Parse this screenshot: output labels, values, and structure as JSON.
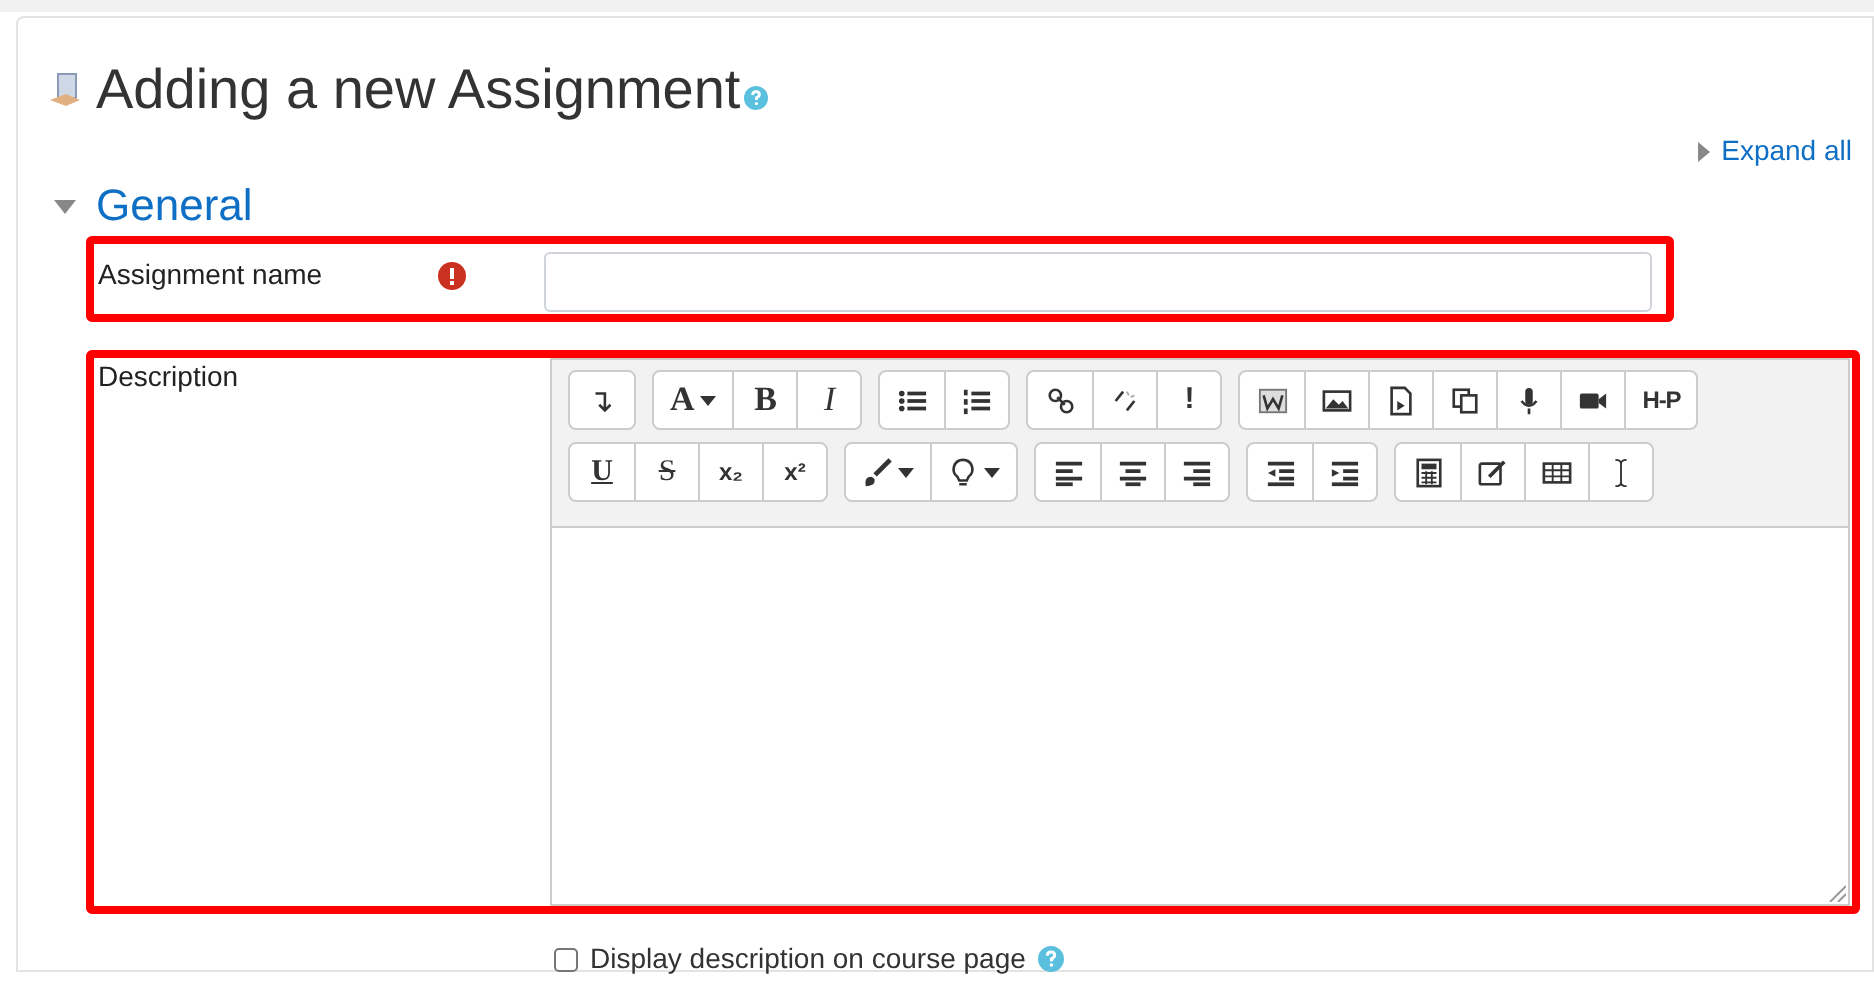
{
  "heading": {
    "title": "Adding a new Assignment"
  },
  "expand_all": "Expand all",
  "section": {
    "title": "General",
    "expanded": true
  },
  "assignment_name": {
    "label": "Assignment name",
    "required": true
  },
  "description": {
    "label": "Description",
    "toolbar_rows": [
      [
        [
          {
            "kind": "collapse"
          }
        ],
        [
          {
            "kind": "font",
            "label": "A"
          },
          {
            "kind": "bold",
            "label": "B"
          },
          {
            "kind": "italic",
            "label": "I"
          }
        ],
        [
          {
            "kind": "bullets"
          },
          {
            "kind": "numbers"
          }
        ],
        [
          {
            "kind": "link"
          },
          {
            "kind": "unlink"
          },
          {
            "kind": "bang",
            "label": "!"
          }
        ],
        [
          {
            "kind": "word"
          },
          {
            "kind": "image"
          },
          {
            "kind": "media"
          },
          {
            "kind": "copy"
          },
          {
            "kind": "mic"
          },
          {
            "kind": "video"
          },
          {
            "kind": "h5p",
            "label": "H-P"
          }
        ]
      ],
      [
        [
          {
            "kind": "underline",
            "label": "U"
          },
          {
            "kind": "strike",
            "label": "S"
          },
          {
            "kind": "sub",
            "label": "x₂"
          },
          {
            "kind": "sup",
            "label": "x²"
          }
        ],
        [
          {
            "kind": "brush"
          },
          {
            "kind": "bulb"
          }
        ],
        [
          {
            "kind": "align-left"
          },
          {
            "kind": "align-center"
          },
          {
            "kind": "align-right"
          }
        ],
        [
          {
            "kind": "outdent"
          },
          {
            "kind": "indent"
          }
        ],
        [
          {
            "kind": "calc"
          },
          {
            "kind": "edit"
          },
          {
            "kind": "table"
          },
          {
            "kind": "cursor"
          }
        ]
      ]
    ]
  },
  "display_description": {
    "label": "Display description on course page",
    "checked": false
  }
}
